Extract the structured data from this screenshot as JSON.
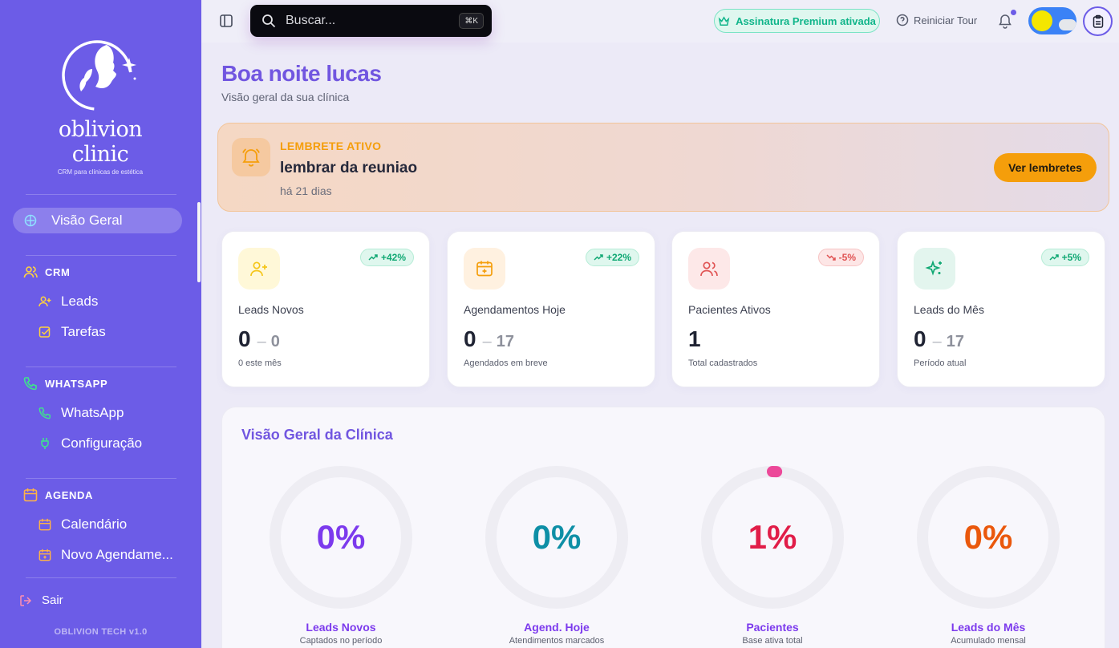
{
  "sidebar": {
    "logo_name": "oblivion clinic",
    "logo_tagline": "CRM para clínicas de estética",
    "overview_label": "Visão Geral",
    "crm_header": "CRM",
    "leads_label": "Leads",
    "tasks_label": "Tarefas",
    "whatsapp_header": "WHATSAPP",
    "whatsapp_label": "WhatsApp",
    "config_label": "Configuração",
    "agenda_header": "AGENDA",
    "calendar_label": "Calendário",
    "new_appointment_label": "Novo Agendame...",
    "logout_label": "Sair",
    "version": "OBLIVION TECH v1.0"
  },
  "topbar": {
    "search_placeholder": "Buscar...",
    "search_shortcut": "⌘K",
    "premium_label": "Assinatura Premium ativada",
    "tour_label": "Reiniciar Tour"
  },
  "header": {
    "greeting": "Boa noite lucas",
    "subtitle": "Visão geral da sua clínica"
  },
  "reminder": {
    "label": "LEMBRETE ATIVO",
    "title": "lembrar da reuniao",
    "time": "há 21 dias",
    "button": "Ver lembretes"
  },
  "cards": [
    {
      "label": "Leads Novos",
      "value": "0",
      "value2": "0",
      "desc": "0 este mês",
      "badge": "+42%",
      "trend": "up",
      "icon": "user-plus-icon",
      "color": "#f5c518"
    },
    {
      "label": "Agendamentos Hoje",
      "value": "0",
      "value2": "17",
      "desc": "Agendados em breve",
      "badge": "+22%",
      "trend": "up",
      "icon": "calendar-plus-icon",
      "color": "#f59e0b"
    },
    {
      "label": "Pacientes Ativos",
      "value": "1",
      "value2": "",
      "desc": "Total cadastrados",
      "badge": "-5%",
      "trend": "down",
      "icon": "users-icon",
      "color": "#e05353"
    },
    {
      "label": "Leads do Mês",
      "value": "0",
      "value2": "17",
      "desc": "Período atual",
      "badge": "+5%",
      "trend": "up",
      "icon": "sparkles-icon",
      "color": "#10a873"
    }
  ],
  "overview": {
    "title": "Visão Geral da Clínica",
    "rings": [
      {
        "percent": "0%",
        "value": 0,
        "label": "Leads Novos",
        "desc": "Captados no período",
        "color": "#7c3aed"
      },
      {
        "percent": "0%",
        "value": 0,
        "label": "Agend. Hoje",
        "desc": "Atendimentos marcados",
        "color": "#0e8fa6"
      },
      {
        "percent": "1%",
        "value": 1,
        "label": "Pacientes",
        "desc": "Base ativa total",
        "color": "#e11d48"
      },
      {
        "percent": "0%",
        "value": 0,
        "label": "Leads do Mês",
        "desc": "Acumulado mensal",
        "color": "#ea580c"
      }
    ]
  }
}
